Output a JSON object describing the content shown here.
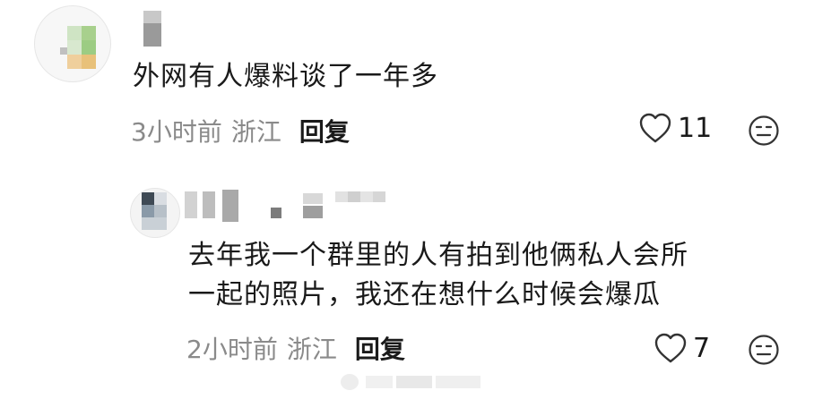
{
  "comment": {
    "text": "外网有人爆料谈了一年多",
    "time": "3小时前",
    "location": "浙江",
    "reply_label": "回复",
    "like_count": "11"
  },
  "reply": {
    "text_line1": "去年我一个群里的人有拍到他俩私人会所",
    "text_line2": "一起的照片，我还在想什么时候会爆瓜",
    "time": "2小时前",
    "location": "浙江",
    "reply_label": "回复",
    "like_count": "7"
  },
  "icons": {
    "like": "heart-outline-icon",
    "dislike": "neutral-face-icon"
  },
  "colors": {
    "text": "#1a1a1a",
    "meta": "#8a8a8a"
  }
}
